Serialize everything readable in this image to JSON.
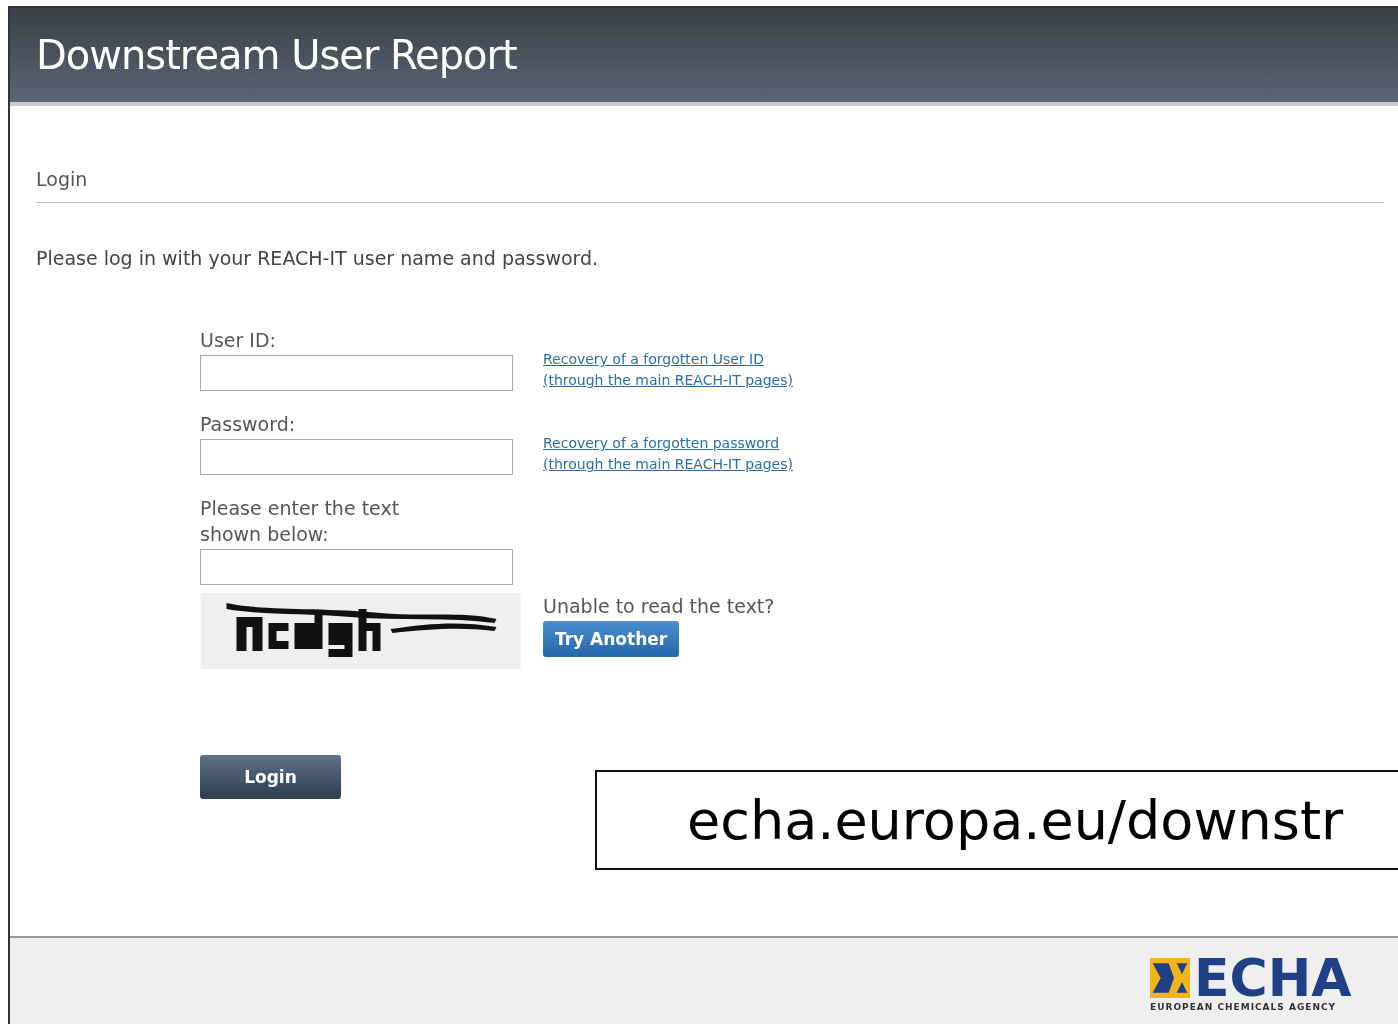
{
  "header": {
    "title": "Downstream User Report"
  },
  "section": {
    "title": "Login"
  },
  "intro": "Please log in with your REACH-IT user name and password.",
  "fields": [
    {
      "label": "User ID:",
      "links": [
        "Recovery of a forgotten User ID",
        "(through the main REACH-IT pages)"
      ]
    },
    {
      "label": "Password:",
      "links": [
        "Recovery of a forgotten password",
        "(through the main REACH-IT pages)"
      ]
    },
    {
      "label": "Please enter the text shown below:"
    }
  ],
  "captcha": {
    "prompt": "Unable to read the text?",
    "button": "Try Another"
  },
  "login_button": "Login",
  "url_box": "echa.europa.eu/downstr",
  "footer": {
    "logo_text": "ECHA",
    "logo_subtitle": "EUROPEAN CHEMICALS AGENCY"
  }
}
